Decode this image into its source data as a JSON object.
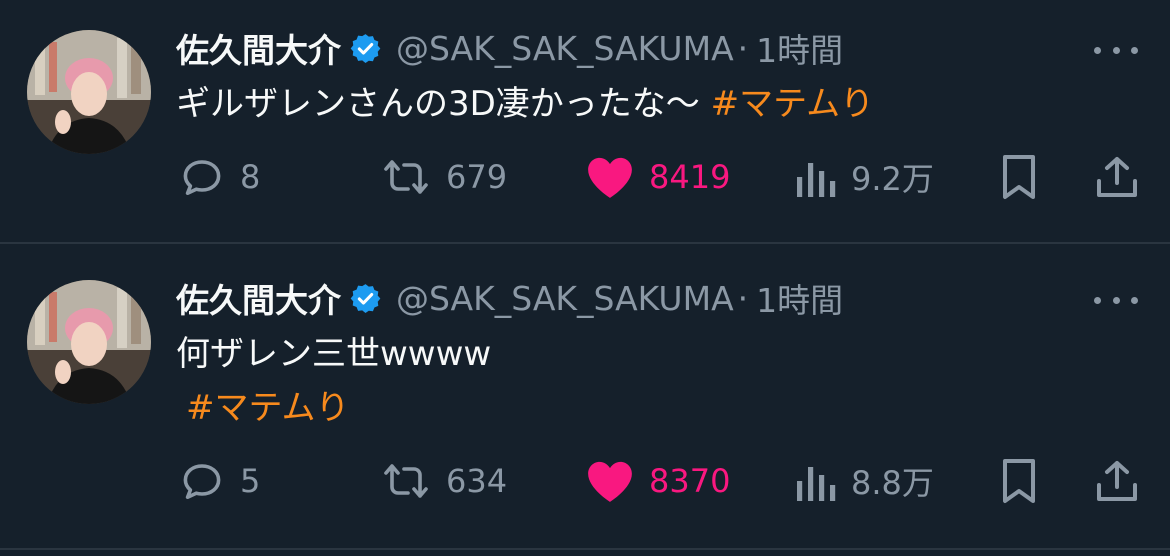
{
  "tweets": [
    {
      "display_name": "佐久間大介",
      "handle": "@SAK_SAK_SAKUMA",
      "separator": "·",
      "time": "1時間",
      "text": "ギルザレンさんの3D凄かったな〜 ",
      "hashtag": "#マテムり",
      "replies": "8",
      "retweets": "679",
      "likes": "8419",
      "views": "9.2万"
    },
    {
      "display_name": "佐久間大介",
      "handle": "@SAK_SAK_SAKUMA",
      "separator": "·",
      "time": "1時間",
      "text": "何ザレン三世wwww",
      "hashtag": "#マテムり",
      "replies": "5",
      "retweets": "634",
      "likes": "8370",
      "views": "8.8万"
    }
  ],
  "colors": {
    "background": "#15202b",
    "primary_text": "#f7f9f9",
    "secondary_text": "#8b98a5",
    "hashtag": "#f78a1d",
    "like": "#f91880",
    "verified": "#1d9bf0"
  },
  "icons": [
    "verified-badge-icon",
    "more-icon",
    "reply-icon",
    "retweet-icon",
    "heart-icon",
    "views-icon",
    "bookmark-icon",
    "share-icon"
  ]
}
